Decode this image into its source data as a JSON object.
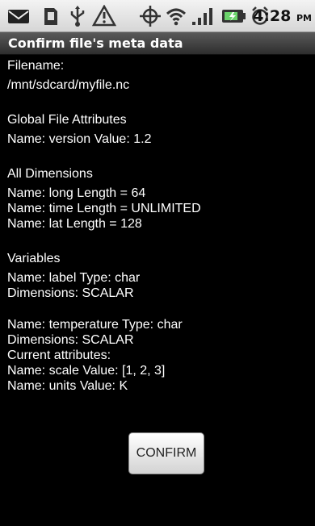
{
  "status_bar": {
    "time": "4:28",
    "ampm": "PM",
    "icons": [
      "mail-icon",
      "sd-card-icon",
      "usb-icon",
      "warning-icon",
      "gps-icon",
      "wifi-icon",
      "signal-icon",
      "battery-icon",
      "alarm-icon"
    ]
  },
  "titlebar": {
    "title": "Confirm file's meta data"
  },
  "content": {
    "filename_label": "Filename:",
    "filename_value": "/mnt/sdcard/myfile.nc",
    "global_heading": "Global File Attributes",
    "global_attr": "Name: version Value: 1.2",
    "dims_heading": "All Dimensions",
    "dims": [
      "Name: long Length = 64",
      "Name: time Length = UNLIMITED",
      "Name: lat Length = 128"
    ],
    "vars_heading": "Variables",
    "var1": [
      "Name: label Type: char",
      "Dimensions: SCALAR"
    ],
    "var2": [
      "Name: temperature Type: char",
      "Dimensions: SCALAR",
      "Current attributes:",
      "Name: scale Value: [1, 2, 3]",
      "Name: units Value: K"
    ]
  },
  "confirm_button": {
    "label": "CONFIRM"
  }
}
